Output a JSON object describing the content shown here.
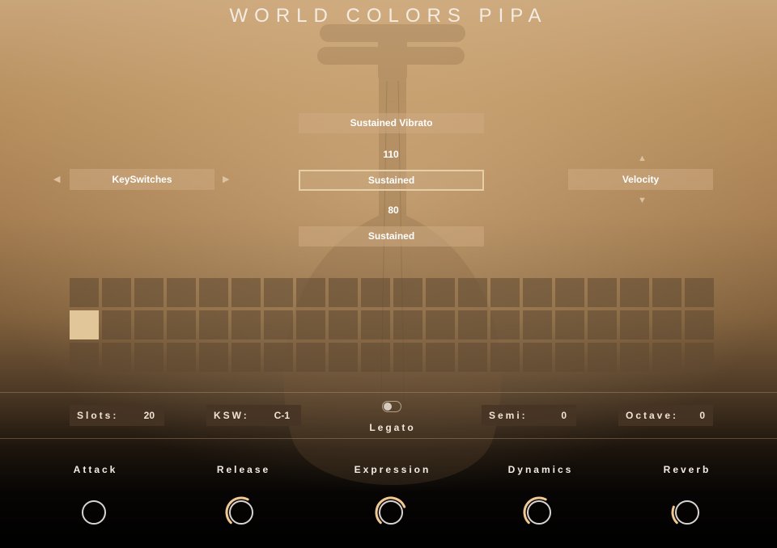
{
  "app": {
    "title": "WORLD COLORS PIPA"
  },
  "articulations": {
    "upper": "Sustained Vibrato",
    "upper_velocity": "110",
    "selected": "Sustained",
    "lower_velocity": "80",
    "lower": "Sustained"
  },
  "mode_selector": {
    "label": "KeySwitches"
  },
  "switch_selector": {
    "label": "Velocity"
  },
  "slot_grid": {
    "rows": 3,
    "columns": 20,
    "active_row": 2,
    "active_column": 1
  },
  "settings": {
    "slots_label": "Slots:",
    "slots_value": "20",
    "ksw_label": "KSW:",
    "ksw_value": "C-1",
    "legato_label": "Legato",
    "legato_on": false,
    "semi_label": "Semi:",
    "semi_value": "0",
    "octave_label": "Octave:",
    "octave_value": "0"
  },
  "knobs": [
    {
      "label": "Attack",
      "level": 0.0
    },
    {
      "label": "Release",
      "level": 0.6
    },
    {
      "label": "Expression",
      "level": 0.75
    },
    {
      "label": "Dynamics",
      "level": 0.6
    },
    {
      "label": "Reverb",
      "level": 0.25
    }
  ],
  "colors": {
    "accent": "#e0c699",
    "knob_ring": "#d9d4cf",
    "knob_arc": "#f2c892"
  },
  "icons": {
    "prev": "triangle-left-icon",
    "next": "triangle-right-icon",
    "up": "triangle-up-icon",
    "down": "triangle-down-icon"
  }
}
